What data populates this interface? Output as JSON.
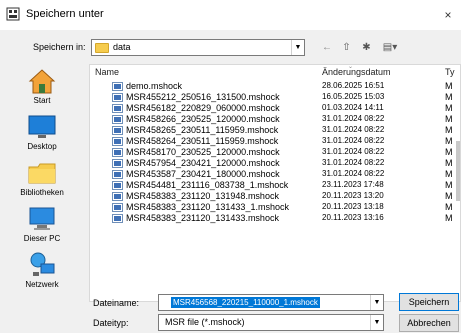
{
  "window": {
    "title": "Speichern unter",
    "close_glyph": "×"
  },
  "lookin": {
    "label": "Speichern in:",
    "value": "data"
  },
  "toolbar": {
    "back_glyph": "←",
    "up_glyph": "⇧",
    "new_glyph": "✱",
    "view_glyph": "▤▾"
  },
  "places": [
    {
      "label": "Start",
      "icon": "star-quickaccess-icon"
    },
    {
      "label": "Desktop",
      "icon": "desktop-icon"
    },
    {
      "label": "Bibliotheken",
      "icon": "libraries-folder-icon"
    },
    {
      "label": "Dieser PC",
      "icon": "computer-icon"
    },
    {
      "label": "Netzwerk",
      "icon": "network-icon"
    }
  ],
  "columns": {
    "name": "Name",
    "date": "Änderungsdatum",
    "type": "Ty"
  },
  "files": [
    {
      "name": "demo.mshock",
      "date": "28.06.2025 16:51",
      "type": "M"
    },
    {
      "name": "MSR455212_250516_131500.mshock",
      "date": "16.05.2025 15:03",
      "type": "M"
    },
    {
      "name": "MSR456182_220829_060000.mshock",
      "date": "01.03.2024 14:11",
      "type": "M"
    },
    {
      "name": "MSR458266_230525_120000.mshock",
      "date": "31.01.2024 08:22",
      "type": "M"
    },
    {
      "name": "MSR458265_230511_115959.mshock",
      "date": "31.01.2024 08:22",
      "type": "M"
    },
    {
      "name": "MSR458264_230511_115959.mshock",
      "date": "31.01.2024 08:22",
      "type": "M"
    },
    {
      "name": "MSR458170_230525_120000.mshock",
      "date": "31.01.2024 08:22",
      "type": "M"
    },
    {
      "name": "MSR457954_230421_120000.mshock",
      "date": "31.01.2024 08:22",
      "type": "M"
    },
    {
      "name": "MSR453587_230421_180000.mshock",
      "date": "31.01.2024 08:22",
      "type": "M"
    },
    {
      "name": "MSR454481_231116_083738_1.mshock",
      "date": "23.11.2023 17:48",
      "type": "M"
    },
    {
      "name": "MSR458383_231120_131948.mshock",
      "date": "20.11.2023 13:20",
      "type": "M"
    },
    {
      "name": "MSR458383_231120_131433_1.mshock",
      "date": "20.11.2023 13:18",
      "type": "M"
    },
    {
      "name": "MSR458383_231120_131433.mshock",
      "date": "20.11.2023 13:16",
      "type": "M"
    }
  ],
  "filename": {
    "label": "Dateiname:",
    "value": "MSR456568_220215_110000_1.mshock"
  },
  "filetype": {
    "label": "Dateityp:",
    "value": "MSR file (*.mshock)"
  },
  "buttons": {
    "save": "Speichern",
    "cancel": "Abbrechen"
  },
  "colors": {
    "accent": "#0078d7",
    "folder": "#f6cc4e",
    "file_icon": "#3e6fb5"
  }
}
